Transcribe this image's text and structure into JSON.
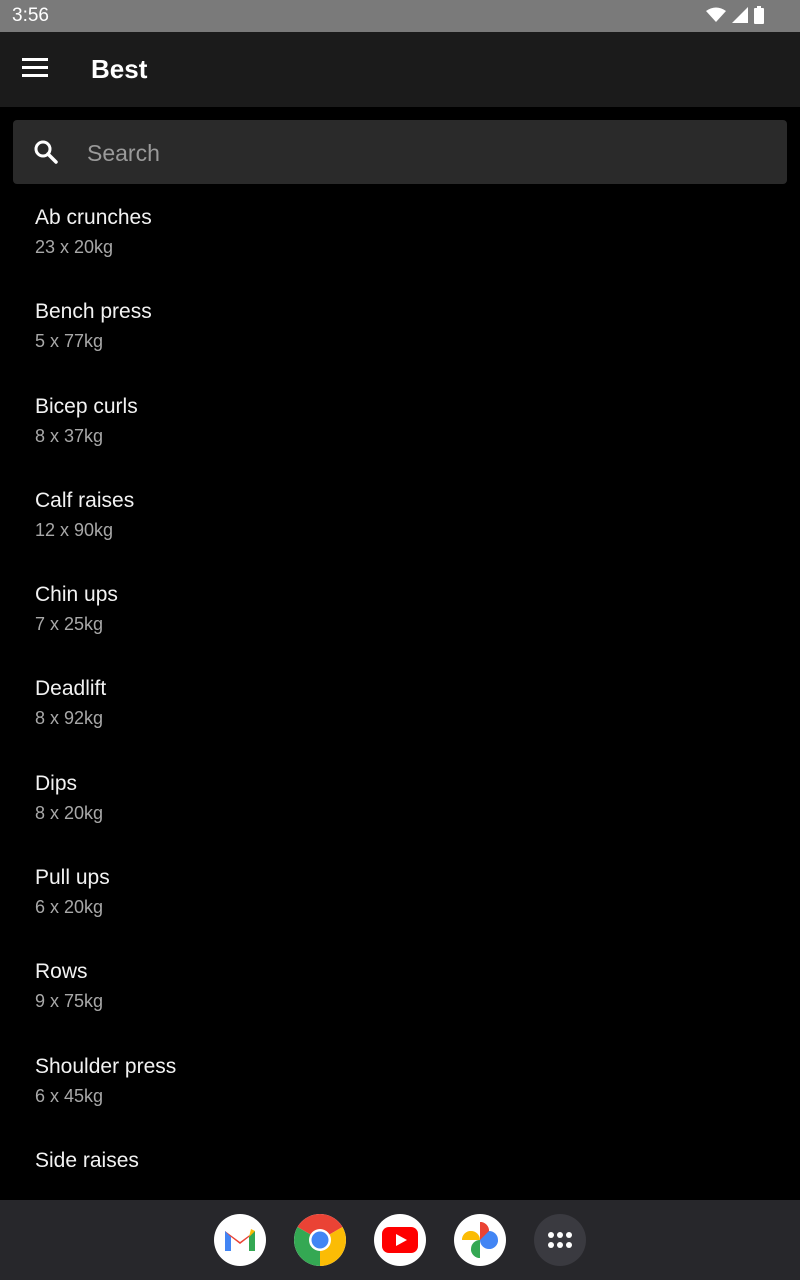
{
  "status_bar": {
    "time": "3:56"
  },
  "app_bar": {
    "title": "Best"
  },
  "search": {
    "placeholder": "Search",
    "value": ""
  },
  "exercises": [
    {
      "name": "Ab crunches",
      "detail": "23 x 20kg"
    },
    {
      "name": "Bench press",
      "detail": "5 x 77kg"
    },
    {
      "name": "Bicep curls",
      "detail": "8 x 37kg"
    },
    {
      "name": "Calf raises",
      "detail": "12 x 90kg"
    },
    {
      "name": "Chin ups",
      "detail": "7 x 25kg"
    },
    {
      "name": "Deadlift",
      "detail": "8 x 92kg"
    },
    {
      "name": "Dips",
      "detail": "8 x 20kg"
    },
    {
      "name": "Pull ups",
      "detail": "6 x 20kg"
    },
    {
      "name": "Rows",
      "detail": "9 x 75kg"
    },
    {
      "name": "Shoulder press",
      "detail": "6 x 45kg"
    },
    {
      "name": "Side raises",
      "detail": ""
    }
  ],
  "dock": {
    "apps": [
      "gmail-icon",
      "chrome-icon",
      "youtube-icon",
      "photos-icon",
      "app-drawer-icon"
    ]
  },
  "colors": {
    "status_bar": "#7a7a7a",
    "app_bar": "#1b1b1b",
    "search_bg": "#2a2a2a",
    "dock_bg": "#27272b"
  }
}
